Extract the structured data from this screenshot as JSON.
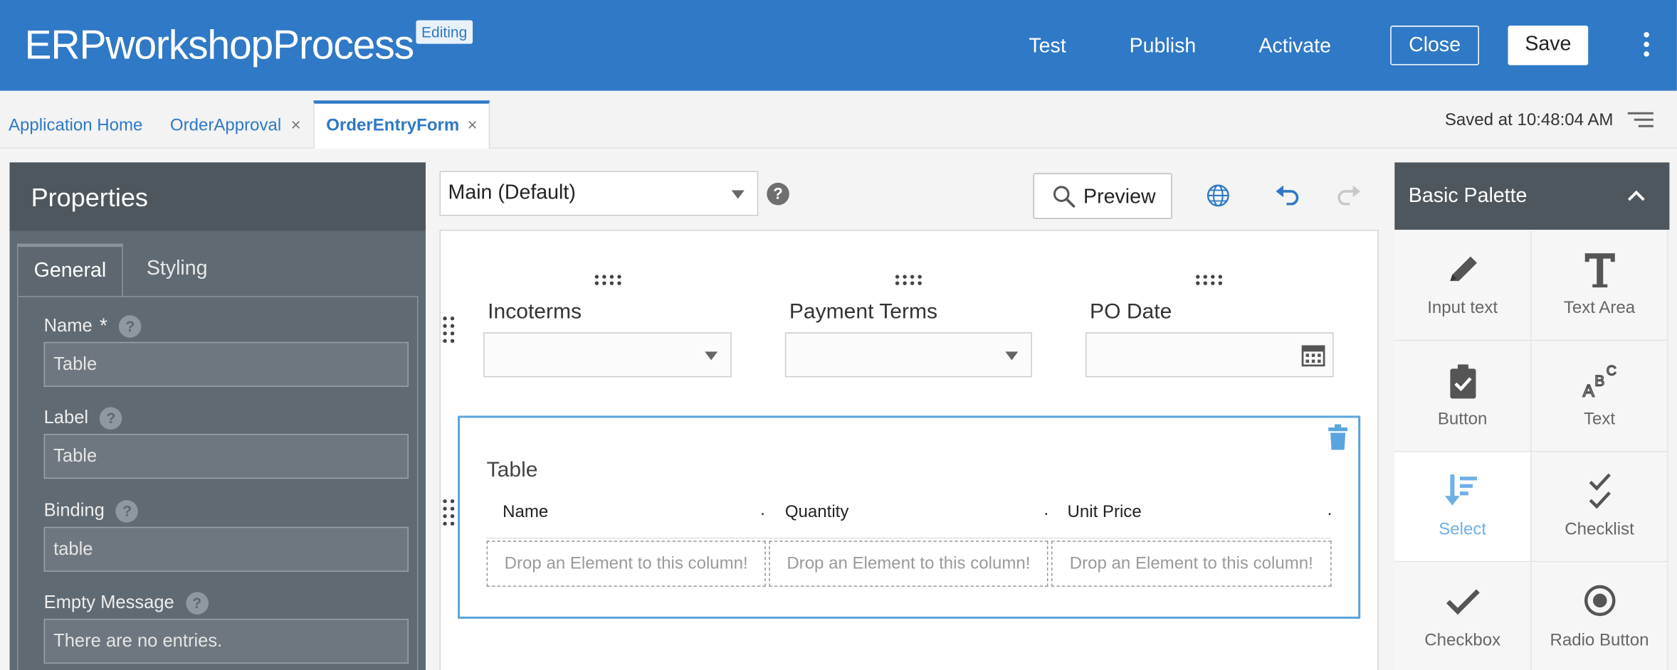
{
  "header": {
    "title": "ERPworkshopProcess",
    "badge": "Editing",
    "links": [
      "Test",
      "Publish",
      "Activate"
    ],
    "close_label": "Close",
    "save_label": "Save"
  },
  "tabs": {
    "items": [
      "Application Home",
      "OrderApproval",
      "OrderEntryForm"
    ],
    "active": "OrderEntryForm",
    "close_glyph": "×",
    "saved_status": "Saved at 10:48:04 AM"
  },
  "properties": {
    "title": "Properties",
    "tab_general": "General",
    "tab_styling": "Styling",
    "required_mark": "*",
    "help_glyph": "?",
    "fields": [
      {
        "label": "Name",
        "value": "Table",
        "required": true
      },
      {
        "label": "Label",
        "value": "Table"
      },
      {
        "label": "Binding",
        "value": "table"
      },
      {
        "label": "Empty Message",
        "value": "There are no entries."
      }
    ]
  },
  "toolbar": {
    "form_select": "Main (Default)",
    "preview_label": "Preview"
  },
  "form": {
    "fields": [
      "Incoterms",
      "Payment Terms",
      "PO Date"
    ],
    "table": {
      "title": "Table",
      "columns": [
        "Name",
        "Quantity",
        "Unit Price"
      ],
      "col_dot": ".",
      "drop_hint": "Drop an Element to this column!"
    }
  },
  "palette": {
    "title": "Basic Palette",
    "items": [
      {
        "label": "Input text",
        "icon": "pencil-icon"
      },
      {
        "label": "Text Area",
        "icon": "text-t-icon"
      },
      {
        "label": "Button",
        "icon": "clipboard-check-icon"
      },
      {
        "label": "Text",
        "icon": "abc-text-icon"
      },
      {
        "label": "Select",
        "icon": "select-list-icon",
        "active": true
      },
      {
        "label": "Checklist",
        "icon": "checklist-icon"
      },
      {
        "label": "Checkbox",
        "icon": "checkmark-icon"
      },
      {
        "label": "Radio Button",
        "icon": "radio-icon"
      }
    ]
  },
  "colors": {
    "brand": "#2f79c6",
    "panel_dark": "#4f575e",
    "selection": "#5aa5de"
  }
}
